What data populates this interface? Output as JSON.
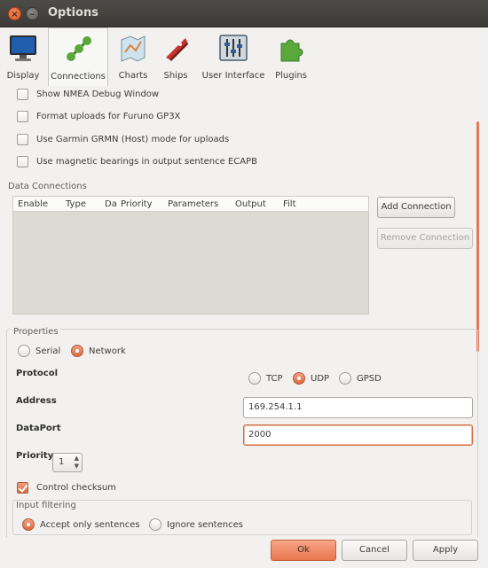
{
  "window": {
    "title": "Options"
  },
  "toolbar": {
    "items": [
      {
        "label": "Display",
        "icon": "display-icon"
      },
      {
        "label": "Connections",
        "icon": "connections-icon",
        "active": true
      },
      {
        "label": "Charts",
        "icon": "charts-icon"
      },
      {
        "label": "Ships",
        "icon": "ships-icon"
      },
      {
        "label": "User Interface",
        "icon": "user-interface-icon"
      },
      {
        "label": "Plugins",
        "icon": "plugins-icon"
      }
    ]
  },
  "general": {
    "options": [
      {
        "label": "Show NMEA Debug Window",
        "checked": false
      },
      {
        "label": "Format uploads for Furuno GP3X",
        "checked": false
      },
      {
        "label": "Use Garmin GRMN (Host) mode for uploads",
        "checked": false
      },
      {
        "label": "Use magnetic bearings in output sentence ECAPB",
        "checked": false
      }
    ]
  },
  "data_connections": {
    "title": "Data Connections",
    "columns": [
      "Enable",
      "Type",
      "Da",
      "Priority",
      "Parameters",
      "Output",
      "Filt"
    ],
    "rows": [],
    "add_label": "Add Connection",
    "remove_label": "Remove Connection"
  },
  "properties": {
    "title": "Properties",
    "type_options": [
      {
        "label": "Serial",
        "selected": false
      },
      {
        "label": "Network",
        "selected": true
      }
    ],
    "protocol_label": "Protocol",
    "protocol_options": [
      {
        "label": "TCP",
        "selected": false
      },
      {
        "label": "UDP",
        "selected": true
      },
      {
        "label": "GPSD",
        "selected": false
      }
    ],
    "address_label": "Address",
    "address_value": "169.254.1.1",
    "dataport_label": "DataPort",
    "dataport_value": "2000",
    "priority_label": "Priority",
    "priority_value": "1",
    "checksum_label": "Control checksum",
    "checksum_checked": true,
    "input_filtering": {
      "title": "Input filtering",
      "options": [
        {
          "label": "Accept only sentences",
          "selected": true
        },
        {
          "label": "Ignore sentences",
          "selected": false
        }
      ]
    }
  },
  "footer": {
    "ok_label": "Ok",
    "cancel_label": "Cancel",
    "apply_label": "Apply"
  },
  "colors": {
    "accent": "#e9764f",
    "titlebar": "#3c3b37",
    "background": "#f2f1f0"
  }
}
